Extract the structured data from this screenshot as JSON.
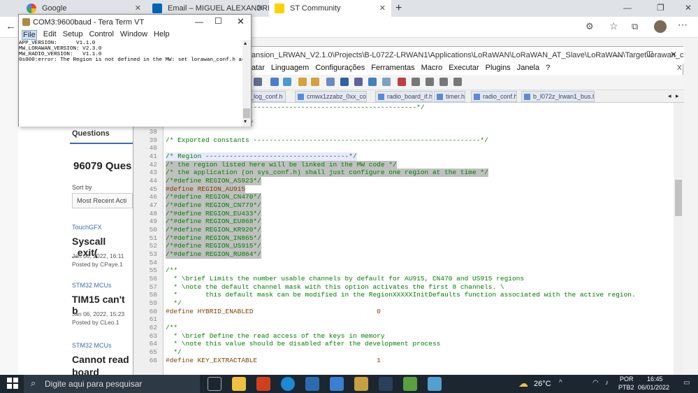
{
  "browser": {
    "tabs": [
      {
        "label": "Google",
        "active": false
      },
      {
        "label": "Email – MIGUEL ALEXANDRE W...",
        "active": false
      },
      {
        "label": "ST Community",
        "active": true
      }
    ],
    "new_tab": "+"
  },
  "community": {
    "questions_tab": "Questions",
    "count_title": "96079 Ques",
    "sort_label": "Sort by",
    "sort_value": "Most Recent Acti",
    "posts": [
      {
        "tag": "TouchGFX",
        "title": "Syscall _exit(",
        "date": "Jan 06, 2022, 16:11",
        "author": "Posted by CPaye.1"
      },
      {
        "tag": "STM32 MCUs",
        "title": "TIM15 can't b",
        "date": "Jan 06, 2022, 15:23",
        "author": "Posted by CLeo.1"
      },
      {
        "tag": "STM32 MCUs",
        "title": "Cannot read",
        "title2": "board (~300u",
        "date": "",
        "author": ""
      }
    ]
  },
  "notepad": {
    "title": "Expansion_LRWAN_V2.1.0\\Projects\\B-L072Z-LRWAN1\\Applications\\LoRaWAN\\LoRaWAN_AT_Slave\\LoRaWAN\\Target\\lorawan_conf....",
    "menu": [
      "ormatar",
      "Linguagem",
      "Configurações",
      "Ferramentas",
      "Macro",
      "Executar",
      "Plugins",
      "Janela",
      "?"
    ],
    "close_x": "X",
    "file_tabs": [
      "_log_conf.h",
      "cmwx1zzabz_0xx_conf.h",
      "radio_board_if.h",
      "timer.h",
      "radio_conf.h",
      "b_l072z_lrwan1_bus.h"
    ],
    "lines": [
      {
        "n": "",
        "t": "---------------------------------------------------------------*/",
        "c": ""
      },
      {
        "n": "",
        "t": "*/",
        "c": ""
      },
      {
        "n": "37",
        "t": "/* USER CODE END ET */",
        "c": ""
      },
      {
        "n": "38",
        "t": "",
        "c": ""
      },
      {
        "n": "39",
        "t": "/* Exported constants ---------------------------------------------------------*/",
        "c": ""
      },
      {
        "n": "40",
        "t": "",
        "c": ""
      },
      {
        "n": "41",
        "t": "/* Region ------------------------------------*/",
        "c": "sel cur"
      },
      {
        "n": "42",
        "t": "/* the region listed here will be linked in the MW code */",
        "c": "sel"
      },
      {
        "n": "43",
        "t": "/* the application (on sys_conf.h) shall just configure one region at the time */",
        "c": "sel"
      },
      {
        "n": "44",
        "t": "/*#define REGION_AS923*/",
        "c": "sel"
      },
      {
        "n": "45",
        "t": "#define REGION_AU915",
        "c": "sel pp"
      },
      {
        "n": "46",
        "t": "/*#define REGION_CN470*/",
        "c": "sel"
      },
      {
        "n": "47",
        "t": "/*#define REGION_CN779*/",
        "c": "sel"
      },
      {
        "n": "48",
        "t": "/*#define REGION_EU433*/",
        "c": "sel"
      },
      {
        "n": "49",
        "t": "/*#define REGION_EU868*/",
        "c": "sel"
      },
      {
        "n": "50",
        "t": "/*#define REGION_KR920*/",
        "c": "sel"
      },
      {
        "n": "51",
        "t": "/*#define REGION_IN865*/",
        "c": "sel"
      },
      {
        "n": "52",
        "t": "/*#define REGION_US915*/",
        "c": "sel"
      },
      {
        "n": "53",
        "t": "/*#define REGION_RU864*/",
        "c": "sel"
      },
      {
        "n": "54",
        "t": "",
        "c": ""
      },
      {
        "n": "55",
        "t": "/**",
        "c": ""
      },
      {
        "n": "56",
        "t": "  * \\brief Limits the number usable channels by default for AU915, CN470 and US915 regions",
        "c": ""
      },
      {
        "n": "57",
        "t": "  * \\note the default channel mask with this option activates the first 8 channels. \\",
        "c": ""
      },
      {
        "n": "58",
        "t": "  *       this default mask can be modified in the RegionXXXXXInitDefaults function associated with the active region.",
        "c": ""
      },
      {
        "n": "59",
        "t": "  */",
        "c": ""
      },
      {
        "n": "60",
        "t": "#define HYBRID_ENABLED                               0",
        "c": "pp"
      },
      {
        "n": "61",
        "t": "",
        "c": ""
      },
      {
        "n": "62",
        "t": "/**",
        "c": ""
      },
      {
        "n": "63",
        "t": "  * \\brief Define the read access of the keys in memory",
        "c": ""
      },
      {
        "n": "64",
        "t": "  * \\note this value should be disabled after the development process",
        "c": ""
      },
      {
        "n": "65",
        "t": "  */",
        "c": ""
      },
      {
        "n": "66",
        "t": "#define KEY_EXTRACTABLE                              1",
        "c": "pp"
      }
    ]
  },
  "teraterm": {
    "title": "COM3:9600baud - Tera Term VT",
    "menu": [
      "File",
      "Edit",
      "Setup",
      "Control",
      "Window",
      "Help"
    ],
    "output": "APP_VERSION:      V1.1.0\nMW_LORAWAN_VERSION: V2.3.0\nMW_RADIO_VERSION:   V1.1.0\n0s000:error: The Region is not defined in the MW: set lorawan_conf.h accordingly"
  },
  "taskbar": {
    "search_placeholder": "Digite aqui para pesquisar",
    "temperature": "26°C",
    "lang1": "POR",
    "lang2": "PTB2",
    "time": "16:45",
    "date": "06/01/2022"
  }
}
